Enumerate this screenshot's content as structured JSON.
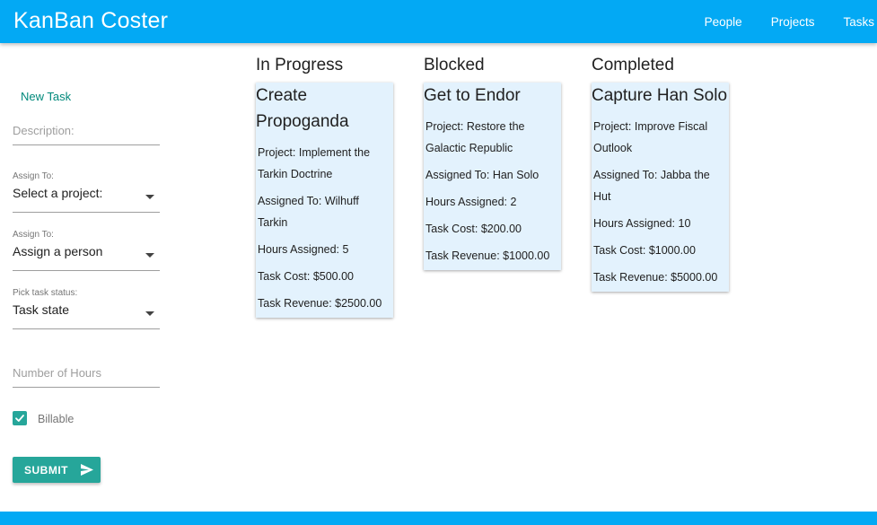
{
  "app": {
    "title": "KanBan Coster",
    "nav": [
      "People",
      "Projects",
      "Tasks"
    ]
  },
  "form": {
    "heading": "New Task",
    "description_placeholder": "Description:",
    "project_label": "Assign To:",
    "project_value": "Select a project:",
    "person_label": "Assign To:",
    "person_value": "Assign a person",
    "status_label": "Pick task status:",
    "status_value": "Task state",
    "hours_placeholder": "Number of Hours",
    "billable_label": "Billable",
    "billable_checked": true,
    "submit_label": "SUBMIT"
  },
  "columns": [
    {
      "title": "In Progress",
      "cards": [
        {
          "title": "Create Propoganda",
          "project": "Project: Implement the Tarkin Doctrine",
          "assigned": "Assigned To: Wilhuff Tarkin",
          "hours": "Hours Assigned: 5",
          "cost": "Task Cost: $500.00",
          "revenue": "Task Revenue: $2500.00"
        }
      ]
    },
    {
      "title": "Blocked",
      "cards": [
        {
          "title": "Get to Endor",
          "project": "Project: Restore the Galactic Republic",
          "assigned": "Assigned To: Han Solo",
          "hours": "Hours Assigned: 2",
          "cost": "Task Cost: $200.00",
          "revenue": "Task Revenue: $1000.00"
        }
      ]
    },
    {
      "title": "Completed",
      "cards": [
        {
          "title": "Capture Han Solo",
          "project": "Project: Improve Fiscal Outlook",
          "assigned": "Assigned To: Jabba the Hut",
          "hours": "Hours Assigned: 10",
          "cost": "Task Cost: $1000.00",
          "revenue": "Task Revenue: $5000.00"
        }
      ]
    }
  ],
  "colors": {
    "appbar": "#03a9f4",
    "accent": "#26a69a",
    "card": "#e3f2fd"
  }
}
